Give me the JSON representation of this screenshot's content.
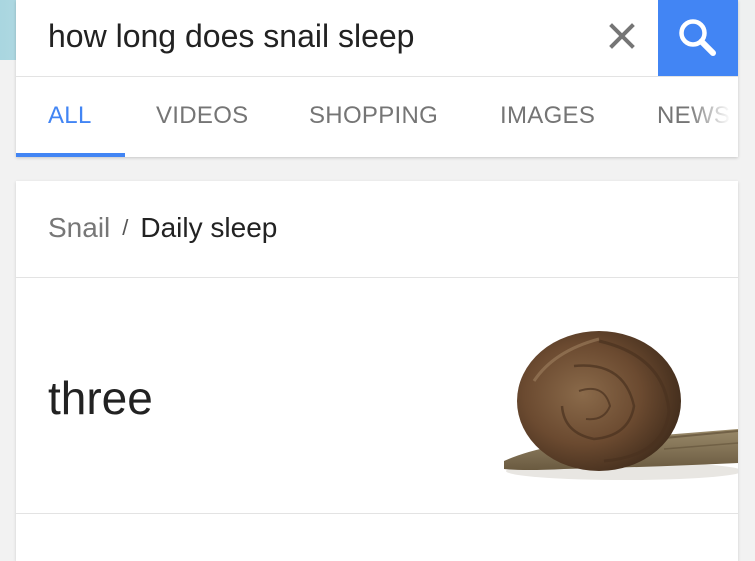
{
  "search": {
    "query": "how long does snail sleep"
  },
  "tabs": [
    {
      "label": "ALL",
      "active": true
    },
    {
      "label": "VIDEOS",
      "active": false
    },
    {
      "label": "SHOPPING",
      "active": false
    },
    {
      "label": "IMAGES",
      "active": false
    },
    {
      "label": "NEWS",
      "active": false
    }
  ],
  "result": {
    "breadcrumb": {
      "parent": "Snail",
      "separator": "/",
      "current": "Daily sleep"
    },
    "answer": "three"
  },
  "icons": {
    "clear": "close-icon",
    "search": "search-icon"
  },
  "colors": {
    "accent": "#4285f4",
    "background": "#f2f2f2"
  }
}
